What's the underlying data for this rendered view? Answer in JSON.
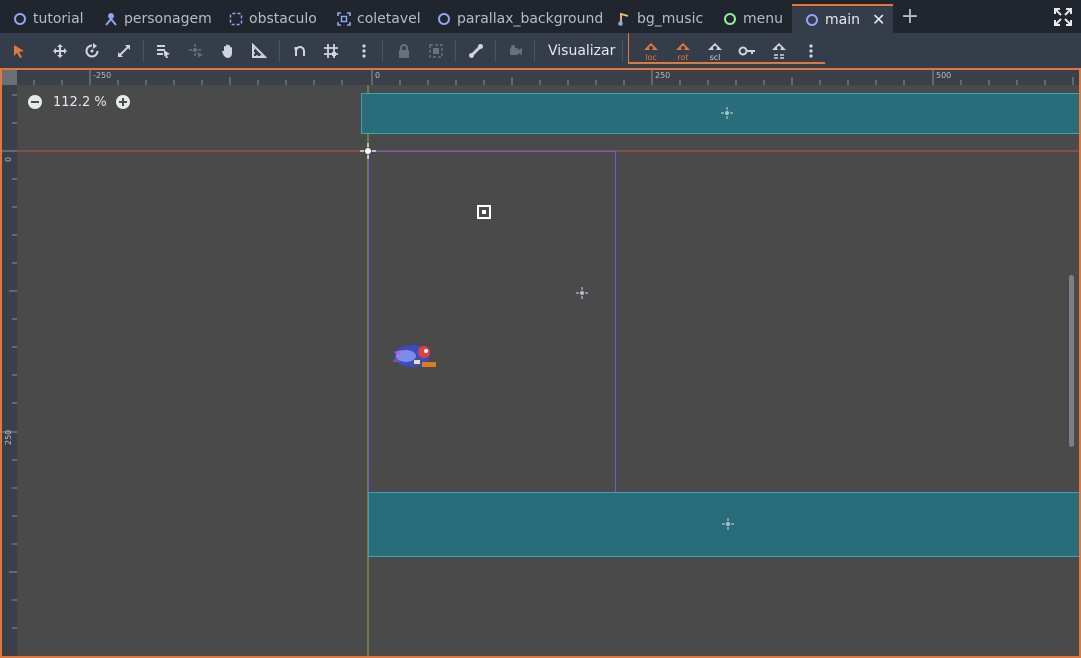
{
  "tabs": [
    {
      "label": "tutorial",
      "icon": "node2d-icon",
      "active": false
    },
    {
      "label": "personagem",
      "icon": "character-body-icon",
      "active": false
    },
    {
      "label": "obstaculo",
      "icon": "area2d-icon",
      "active": false
    },
    {
      "label": "coletavel",
      "icon": "collectable-area-icon",
      "active": false
    },
    {
      "label": "parallax_background",
      "icon": "node2d-icon",
      "active": false
    },
    {
      "label": "bg_music",
      "icon": "audio-stream-player-icon",
      "active": false
    },
    {
      "label": "menu",
      "icon": "control-icon",
      "active": false
    },
    {
      "label": "main",
      "icon": "node2d-icon",
      "active": true
    }
  ],
  "toolbar": {
    "view_menu_label": "Visualizar",
    "animation_keys": [
      "loc",
      "rot",
      "scl"
    ],
    "accent_color": "#e0783c"
  },
  "viewport": {
    "zoom_label": "112.2 %",
    "ruler_h_labels": [
      "-250",
      "0",
      "250",
      "500"
    ],
    "ruler_v_labels": [
      "0",
      "250"
    ]
  },
  "colors": {
    "editor_background": "#21262e",
    "toolbar_background": "#363d4a",
    "canvas_background": "#4a4a4a",
    "collision_shape": "#2a6d7a",
    "origin_x_axis": "#c0504d",
    "origin_y_axis": "#8cb33a"
  }
}
